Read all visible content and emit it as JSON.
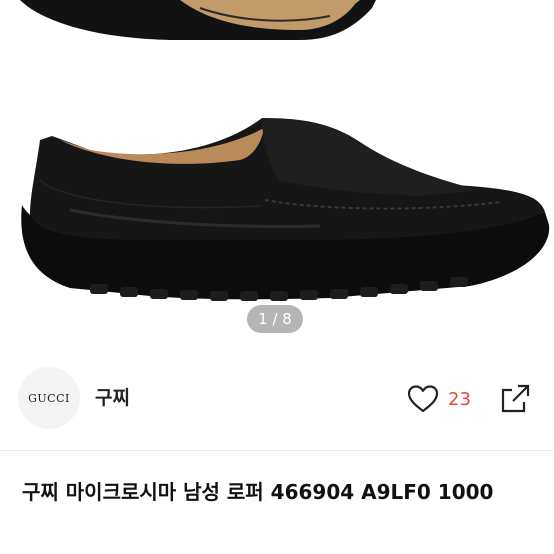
{
  "gallery": {
    "current_page": 1,
    "total_pages": 8,
    "indicator_text": "1 / 8"
  },
  "shop": {
    "logo_text": "GUCCI",
    "name": "구찌",
    "like_icon": "heart-icon",
    "like_count": "23",
    "share_icon": "share-icon"
  },
  "product": {
    "title": "구찌 마이크로시마 남성 로퍼 466904 A9LF0 1000"
  },
  "colors": {
    "accent": "#e8473e",
    "text": "#111111",
    "divider": "#ececec"
  }
}
